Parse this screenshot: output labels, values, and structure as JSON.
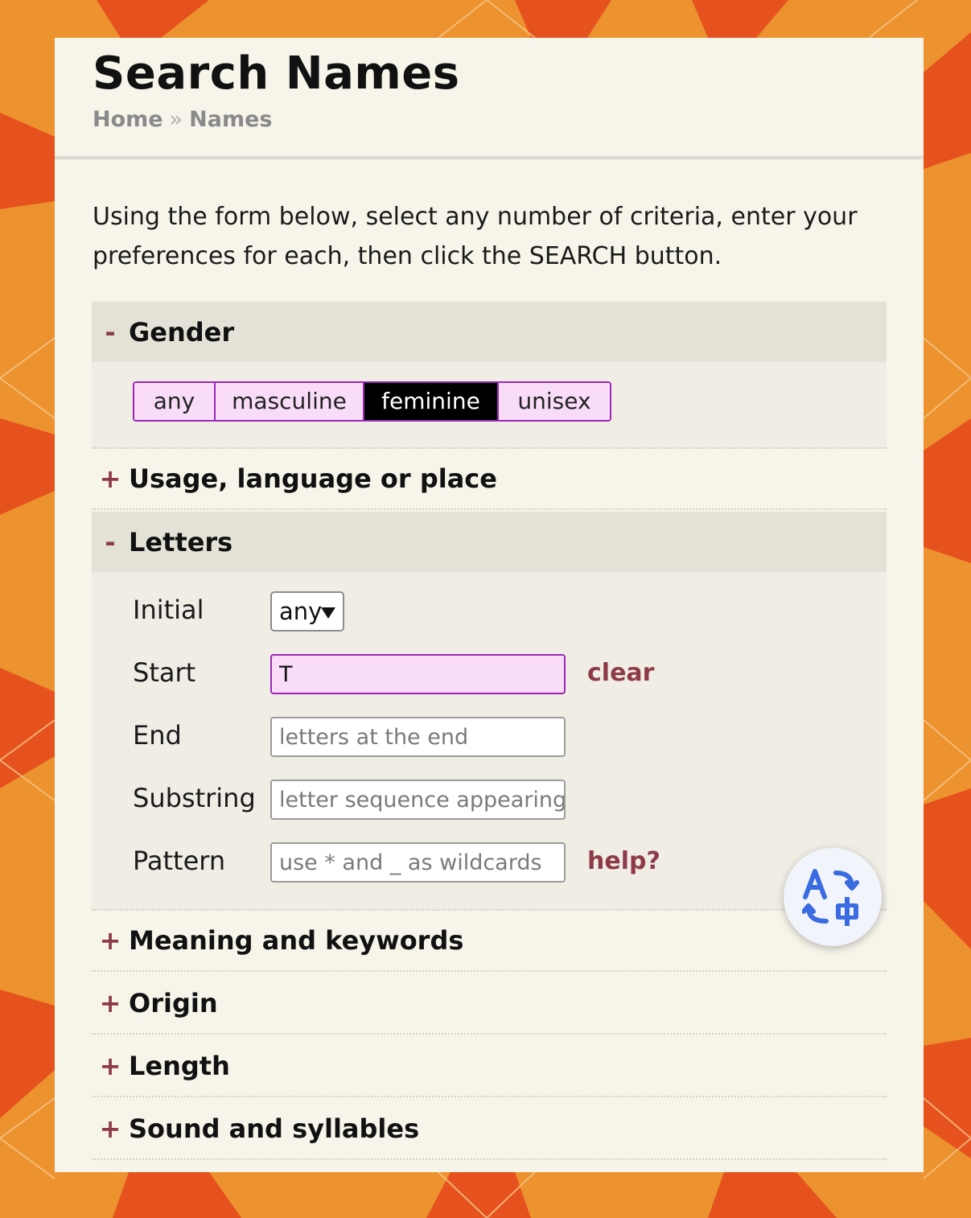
{
  "header": {
    "title": "Search Names",
    "breadcrumb": {
      "home": "Home",
      "separator": "»",
      "current": "Names"
    }
  },
  "intro": "Using the form below, select any number of criteria, enter your preferences for each, then click the SEARCH button.",
  "toggles": {
    "open": "-",
    "closed": "+"
  },
  "sections": {
    "gender": {
      "title": "Gender",
      "options": [
        "any",
        "masculine",
        "feminine",
        "unisex"
      ],
      "selected": "feminine"
    },
    "usage": {
      "title": "Usage, language or place"
    },
    "letters": {
      "title": "Letters",
      "initial": {
        "label": "Initial",
        "value": "any"
      },
      "start": {
        "label": "Start",
        "value": "T",
        "link": "clear"
      },
      "end": {
        "label": "End",
        "placeholder": "letters at the end"
      },
      "substring": {
        "label": "Substring",
        "placeholder": "letter sequence appearing anywhere"
      },
      "pattern": {
        "label": "Pattern",
        "placeholder": "use * and _ as wildcards",
        "link": "help?"
      }
    },
    "meaning": {
      "title": "Meaning and keywords"
    },
    "origin": {
      "title": "Origin"
    },
    "length": {
      "title": "Length"
    },
    "sound": {
      "title": "Sound and syllables"
    }
  },
  "colors": {
    "background": "#e98a2a",
    "panel": "#f7f5ea",
    "accent": "#9b28b8",
    "link": "#8e3a49",
    "selected_bg": "#000000",
    "chip_bg": "#f8dcf8"
  },
  "floating": {
    "icon": "translate-icon"
  }
}
